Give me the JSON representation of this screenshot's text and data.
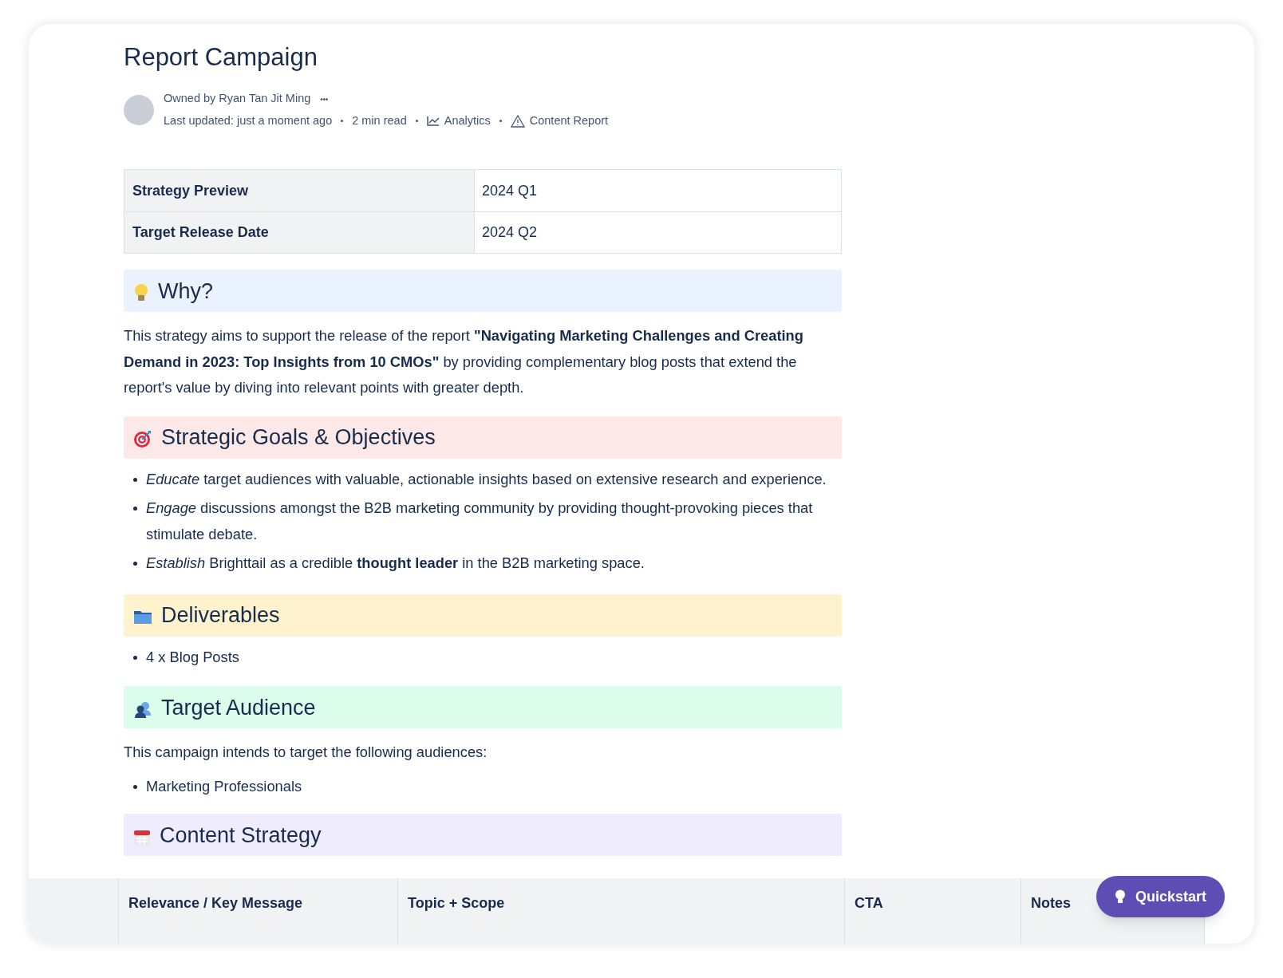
{
  "title": "Report Campaign",
  "byline": {
    "owner": "Owned by Ryan Tan Jit Ming",
    "more": "•••",
    "updated": "Last updated: just a moment ago",
    "read_time": "2 min read",
    "links": [
      {
        "label": "Analytics",
        "kind": "chart"
      },
      {
        "label": "Content Report",
        "kind": "warning"
      }
    ]
  },
  "info_table": [
    {
      "label": "Strategy Preview",
      "value": "2024 Q1"
    },
    {
      "label": "Target Release Date",
      "value": "2024 Q2"
    }
  ],
  "sections": [
    {
      "heading": "Why?",
      "color": "#e9f2fe",
      "blocks": [
        {
          "kind": "paragraph",
          "text": "This strategy aims to support the release of the report **\"Navigating Marketing Challenges and Creating Demand in 2023: Top Insights from 10 CMOs\"** by providing complementary blog posts that extend the report's value by diving into relevant points with greater depth."
        }
      ]
    },
    {
      "heading": "Strategic Goals & Objectives",
      "color": "#fce8e6",
      "blocks": [
        {
          "kind": "bullets",
          "items": [
            "*Educate* target audiences with valuable, actionable insights based on extensive research and experience.",
            "*Engage* discussions amongst the B2B marketing community by providing thought-provoking pieces that stimulate debate.",
            "*Establish* Brighttail as a credible **thought leader** in the B2B marketing space."
          ]
        }
      ]
    },
    {
      "heading": "Deliverables",
      "color": "#fef3cd",
      "blocks": [
        {
          "kind": "bullets",
          "items": [
            "4 x Blog Posts"
          ]
        }
      ]
    },
    {
      "heading": "Target Audience",
      "color": "#dcfcec",
      "blocks": [
        {
          "kind": "paragraph",
          "text": "This campaign intends to target the following audiences:"
        },
        {
          "kind": "bullets",
          "items": [
            "Marketing Professionals"
          ]
        }
      ]
    },
    {
      "heading": "Content Strategy",
      "color": "#efedfd"
    }
  ],
  "strategy_table": {
    "columns": [
      "Relevance / Key Message",
      "Topic + Scope",
      "CTA",
      "Notes"
    ]
  },
  "quickstart": "Quickstart"
}
